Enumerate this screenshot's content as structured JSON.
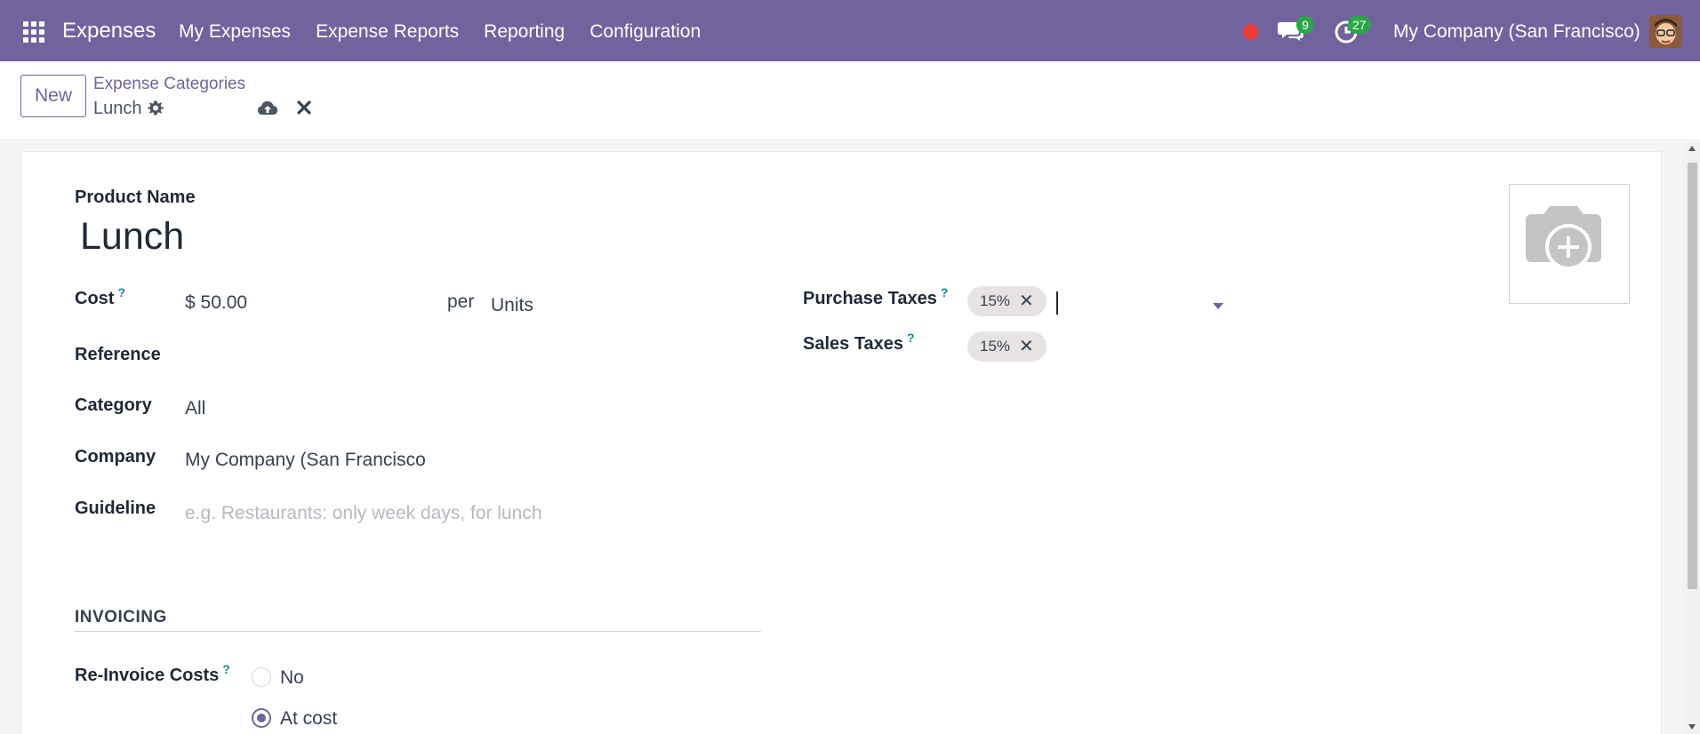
{
  "colors": {
    "brand": "#71639e",
    "badge": "#28a745",
    "record": "#e63c3c",
    "help": "#0f8a9d"
  },
  "navbar": {
    "app_name": "Expenses",
    "menu": [
      "My Expenses",
      "Expense Reports",
      "Reporting",
      "Configuration"
    ],
    "chat_badge": "9",
    "activity_badge": "27",
    "company": "My Company (San Francisco)"
  },
  "control": {
    "new_label": "New",
    "breadcrumb_parent": "Expense Categories",
    "breadcrumb_current": "Lunch"
  },
  "form": {
    "product_name_label": "Product Name",
    "product_name": "Lunch",
    "cost_label": "Cost",
    "cost_help": "?",
    "cost_value": "$ 50.00",
    "per_label": "per",
    "uom_value": "Units",
    "reference_label": "Reference",
    "category_label": "Category",
    "category_value": "All",
    "company_label": "Company",
    "company_value": "My Company (San Francisco",
    "guideline_label": "Guideline",
    "guideline_placeholder": "e.g. Restaurants: only week days, for lunch",
    "purchase_taxes_label": "Purchase Taxes",
    "purchase_taxes_help": "?",
    "purchase_taxes_tags": [
      "15%"
    ],
    "sales_taxes_label": "Sales Taxes",
    "sales_taxes_help": "?",
    "sales_taxes_tags": [
      "15%"
    ],
    "invoicing_title": "INVOICING",
    "reinvoice_label": "Re-Invoice Costs",
    "reinvoice_help": "?",
    "reinvoice_options": [
      {
        "label": "No",
        "checked": false
      },
      {
        "label": "At cost",
        "checked": true
      }
    ]
  }
}
